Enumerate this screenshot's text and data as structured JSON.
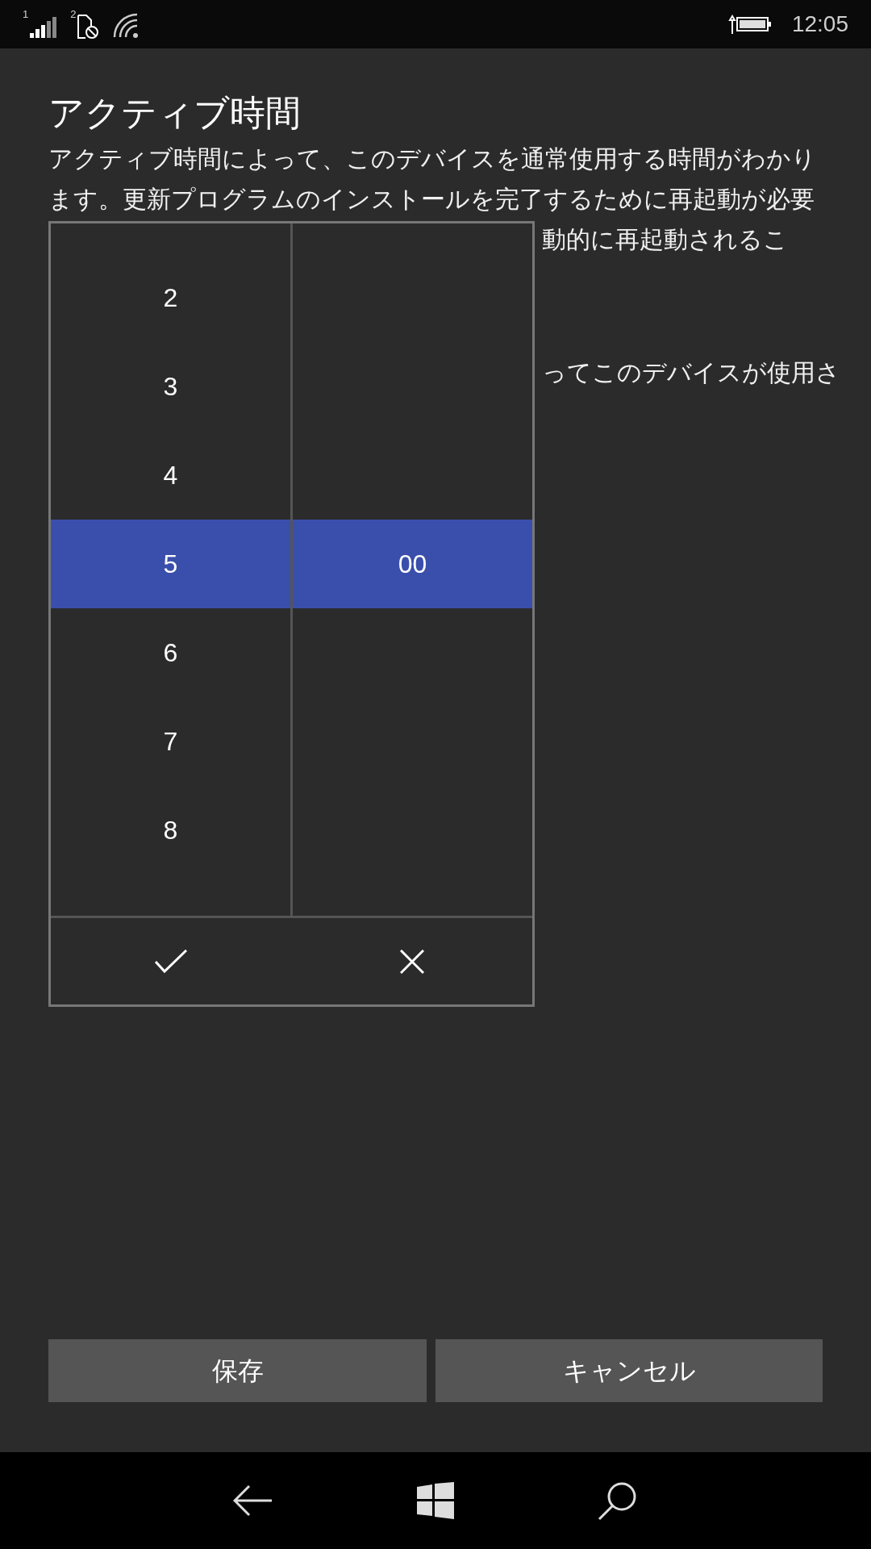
{
  "status_bar": {
    "sim_1": "1",
    "sim_2": "2",
    "time": "12:05"
  },
  "title": "アクティブ時間",
  "description_lines": [
    "アクティブ時間によって、このデバイスを通常使用する時間がわかり",
    "ます。更新プログラムのインストールを完了するために再起動が必要",
    "動的に再起動されるこ"
  ],
  "second_paragraph_fragment": "ってこのデバイスが使用さ",
  "time_picker": {
    "hours": [
      {
        "label": "2",
        "selected": false
      },
      {
        "label": "3",
        "selected": false
      },
      {
        "label": "4",
        "selected": false
      },
      {
        "label": "5",
        "selected": true
      },
      {
        "label": "6",
        "selected": false
      },
      {
        "label": "7",
        "selected": false
      },
      {
        "label": "8",
        "selected": false
      }
    ],
    "minutes": [
      {
        "label": "00",
        "selected": true
      }
    ]
  },
  "buttons": [
    "保存",
    "キャンセル"
  ]
}
